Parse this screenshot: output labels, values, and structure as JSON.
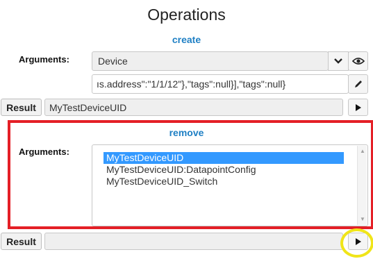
{
  "page": {
    "title": "Operations"
  },
  "create": {
    "link": "create",
    "arguments_label": "Arguments:",
    "select_value": "Device",
    "json_value": "ıs.address\":\"1/1/12\"},\"tags\":null}],\"tags\":null}",
    "result_label": "Result",
    "result_value": "MyTestDeviceUID"
  },
  "remove": {
    "link": "remove",
    "arguments_label": "Arguments:",
    "options": [
      "MyTestDeviceUID",
      "MyTestDeviceUID:DatapointConfig",
      "MyTestDeviceUID_Switch"
    ],
    "selected_index": 0,
    "result_label": "Result",
    "result_value": ""
  },
  "icons": {
    "dropdown": "chevron-down-icon",
    "view": "eye-icon",
    "edit": "pencil-icon",
    "run": "play-icon",
    "scroll_up": "scroll-up-arrow-icon",
    "scroll_down": "scroll-down-arrow-icon"
  },
  "colors": {
    "link": "#1e7fc4",
    "highlight_box": "#e41f26",
    "highlight_circle": "#f0e519",
    "selection": "#3399ff"
  }
}
